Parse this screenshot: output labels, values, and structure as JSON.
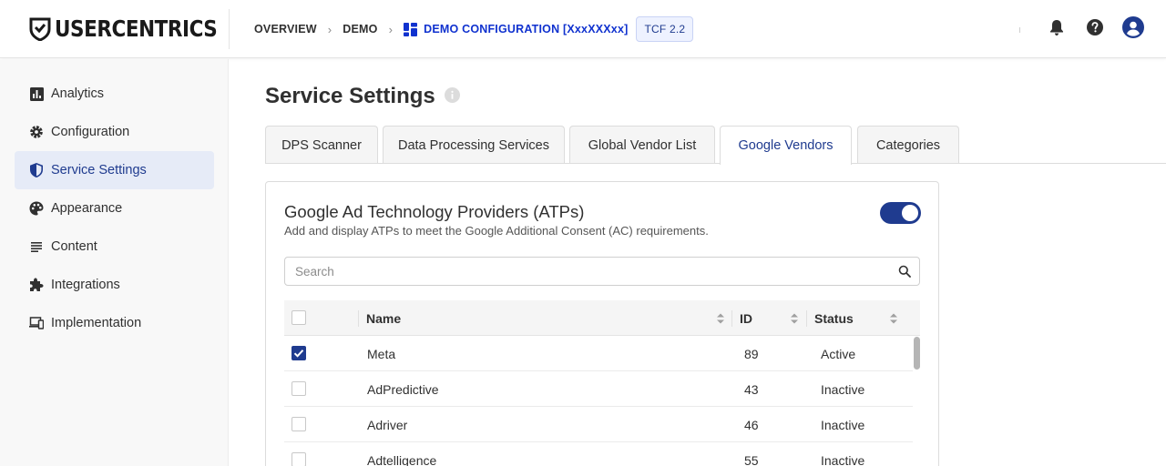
{
  "brand": {
    "name": "USERCENTRICS",
    "accent": "#1f3b8f",
    "link": "#1032cf"
  },
  "breadcrumb": {
    "items": [
      "OVERVIEW",
      "DEMO"
    ],
    "current": "DEMO CONFIGURATION [XxxXXXxx]",
    "badge": "TCF 2.2"
  },
  "header_icons": [
    "bell-icon",
    "help-icon",
    "account-icon"
  ],
  "sidebar": {
    "items": [
      {
        "label": "Analytics",
        "icon": "analytics-icon"
      },
      {
        "label": "Configuration",
        "icon": "gear-icon"
      },
      {
        "label": "Service Settings",
        "icon": "shield-icon",
        "active": true
      },
      {
        "label": "Appearance",
        "icon": "palette-icon"
      },
      {
        "label": "Content",
        "icon": "lines-icon"
      },
      {
        "label": "Integrations",
        "icon": "puzzle-icon"
      },
      {
        "label": "Implementation",
        "icon": "devices-icon"
      }
    ]
  },
  "page": {
    "title": "Service Settings"
  },
  "tabs": [
    {
      "label": "DPS Scanner"
    },
    {
      "label": "Data Processing Services"
    },
    {
      "label": "Global Vendor List"
    },
    {
      "label": "Google Vendors",
      "active": true
    },
    {
      "label": "Categories"
    }
  ],
  "card": {
    "title": "Google Ad Technology Providers (ATPs)",
    "subtitle": "Add and display ATPs to meet the Google Additional Consent (AC) requirements.",
    "enabled": true
  },
  "search": {
    "placeholder": "Search",
    "value": ""
  },
  "table": {
    "columns": [
      "Name",
      "ID",
      "Status"
    ],
    "rows": [
      {
        "name": "Meta",
        "id": "89",
        "status": "Active",
        "checked": true
      },
      {
        "name": "AdPredictive",
        "id": "43",
        "status": "Inactive",
        "checked": false
      },
      {
        "name": "Adriver",
        "id": "46",
        "status": "Inactive",
        "checked": false
      },
      {
        "name": "Adtelligence",
        "id": "55",
        "status": "Inactive",
        "checked": false
      }
    ]
  }
}
